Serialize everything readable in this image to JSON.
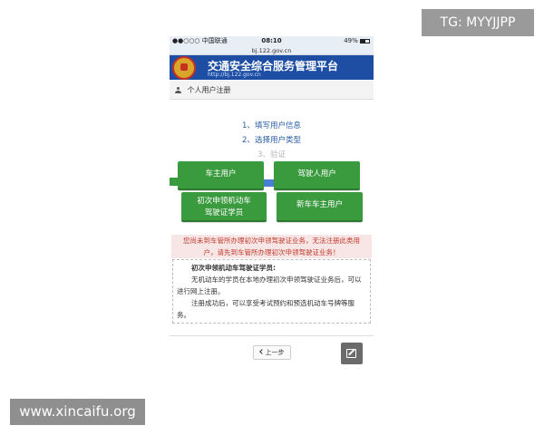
{
  "watermarks": {
    "tg": "TG: MYYJJPP",
    "site": "www.xincaifu.org"
  },
  "status_bar": {
    "carrier": "●●○○○ 中国联通",
    "time": "08:10",
    "battery": "49%"
  },
  "browser": {
    "url": "bj.122.gov.cn"
  },
  "banner": {
    "title": "交通安全综合服务管理平台",
    "url": "http://bj.122.gov.cn"
  },
  "section": {
    "title": "个人用户注册"
  },
  "steps": [
    {
      "label": "1、填写用户信息"
    },
    {
      "label": "2、选择用户类型"
    },
    {
      "label": "3、验证"
    }
  ],
  "user_types": {
    "car_owner": "车主用户",
    "driver": "驾驶人用户",
    "learner_line1": "初次申领机动车",
    "learner_line2": "驾驶证学员",
    "new_car_owner": "新车车主用户"
  },
  "warning": {
    "line1": "您尚未到车管所办理初次申领驾驶证业务，无法注册此类用",
    "line2": "户，请先到车管所办理初次申领驾驶证业务！"
  },
  "info": {
    "title": "初次申领机动车驾驶证学员:",
    "para1": "无机动车的学员在本地办理初次申领驾驶证业务后，可以进行网上注册。",
    "para2": "注册成功后，可以享受考试预约和预选机动车号牌等服务。"
  },
  "nav": {
    "prev": "上一步"
  },
  "colors": {
    "banner_blue": "#1d4ea3",
    "button_green": "#3a9a3e",
    "warning_red": "#c0392b",
    "link_blue": "#2a5ea8"
  },
  "icons": [
    "user-icon",
    "chevron-left-icon",
    "edit-icon",
    "police-emblem-icon",
    "wifi-icon",
    "battery-icon"
  ]
}
